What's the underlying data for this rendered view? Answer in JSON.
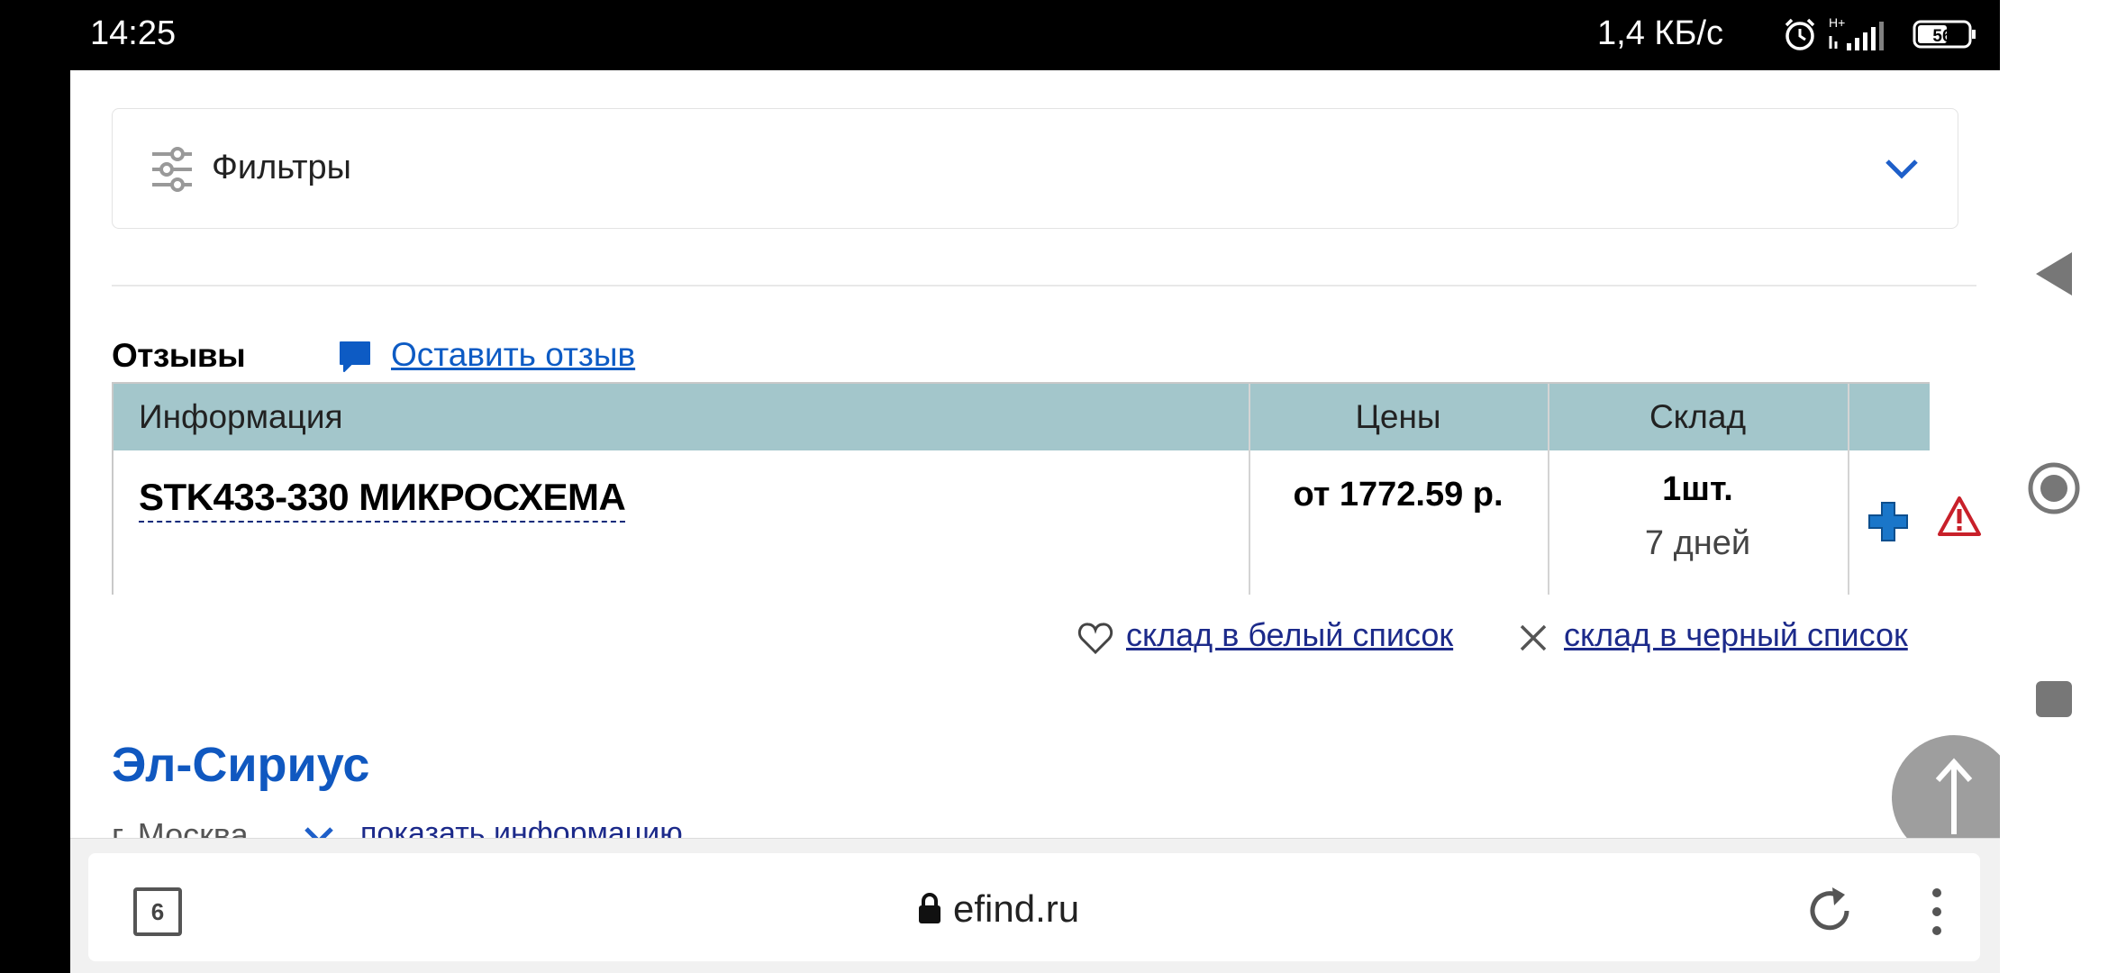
{
  "status_bar": {
    "time": "14:25",
    "network_speed": "1,4 КБ/с",
    "signal_label": "H+",
    "battery": "56"
  },
  "filters": {
    "label": "Фильтры"
  },
  "reviews": {
    "title": "Отзывы",
    "leave_review": "Оставить отзыв"
  },
  "table": {
    "headers": [
      "Информация",
      "Цены",
      "Склад",
      ""
    ],
    "rows": [
      {
        "name": "STK433-330 МИКРОСХЕМА",
        "price": "от 1772.59 р.",
        "stock_qty": "1шт.",
        "stock_days": "7 дней"
      }
    ]
  },
  "lists": {
    "whitelist": "склад в белый список",
    "blacklist": "склад в черный список"
  },
  "company": {
    "name": "Эл-Сириус",
    "city": "г. Москва",
    "show_info": "показать информацию"
  },
  "browser": {
    "tab_count": "6",
    "url": "efind.ru"
  },
  "colors": {
    "link": "#0d5bc4",
    "table_header": "#a3c6cb",
    "company": "#1058c0",
    "scroll_button": "#9e9e9e"
  }
}
